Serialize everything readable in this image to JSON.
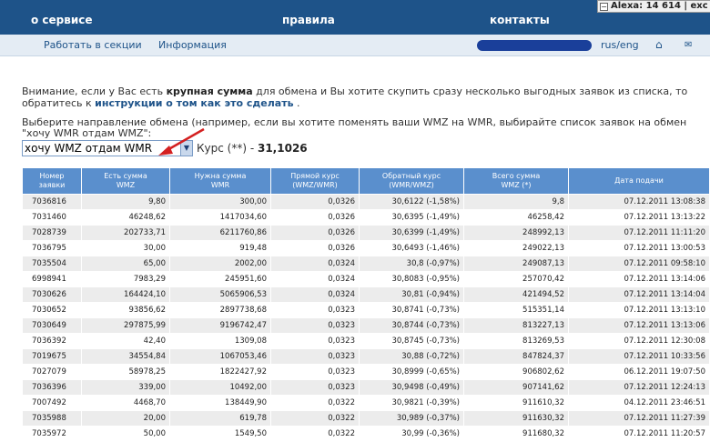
{
  "header": {
    "nav": [
      "о сервисе",
      "правила",
      "контакты"
    ],
    "alexa_label": "Alexa: 14 614 | exc",
    "alexa_box": "−"
  },
  "subnav": {
    "links": [
      "Работать в секции",
      "Информация"
    ],
    "lang": "rus/eng",
    "home_icon": "⌂",
    "mail_icon": "✉"
  },
  "notice": {
    "line1_a": "Внимание, если у Вас есть ",
    "line1_b": "крупная сумма",
    "line1_c": " для обмена и Вы хотите скупить сразу несколько выгодных заявок из списка, то",
    "line2_a": "обратитесь к ",
    "line2_b": "инструкции о том как это сделать",
    "line2_c": " ."
  },
  "direction": {
    "line1": "Выберите направление обмена (например, если вы хотите поменять ваши WMZ на WMR, выбирайте список заявок на обмен",
    "line2": "\"хочу WMR отдам WMZ\":",
    "selected": "хочу WMZ отдам WMR",
    "rate_label": "Курс (**) - ",
    "rate_value": "31,1026"
  },
  "table": {
    "headers": [
      [
        "Номер",
        "заявки"
      ],
      [
        "Есть сумма",
        "WMZ"
      ],
      [
        "Нужна сумма",
        "WMR"
      ],
      [
        "Прямой курс",
        "(WMZ/WMR)"
      ],
      [
        "Обратный курс",
        "(WMR/WMZ)"
      ],
      [
        "Всего сумма",
        "WMZ (*)"
      ],
      [
        "Дата подачи",
        ""
      ]
    ],
    "rows": [
      [
        "7036816",
        "9,80",
        "300,00",
        "0,0326",
        "30,6122 (-1,58%)",
        "9,8",
        "07.12.2011 13:08:38"
      ],
      [
        "7031460",
        "46248,62",
        "1417034,60",
        "0,0326",
        "30,6395 (-1,49%)",
        "46258,42",
        "07.12.2011 13:13:22"
      ],
      [
        "7028739",
        "202733,71",
        "6211760,86",
        "0,0326",
        "30,6399 (-1,49%)",
        "248992,13",
        "07.12.2011 11:11:20"
      ],
      [
        "7036795",
        "30,00",
        "919,48",
        "0,0326",
        "30,6493 (-1,46%)",
        "249022,13",
        "07.12.2011 13:00:53"
      ],
      [
        "7035504",
        "65,00",
        "2002,00",
        "0,0324",
        "30,8 (-0,97%)",
        "249087,13",
        "07.12.2011 09:58:10"
      ],
      [
        "6998941",
        "7983,29",
        "245951,60",
        "0,0324",
        "30,8083 (-0,95%)",
        "257070,42",
        "07.12.2011 13:14:06"
      ],
      [
        "7030626",
        "164424,10",
        "5065906,53",
        "0,0324",
        "30,81 (-0,94%)",
        "421494,52",
        "07.12.2011 13:14:04"
      ],
      [
        "7030652",
        "93856,62",
        "2897738,68",
        "0,0323",
        "30,8741 (-0,73%)",
        "515351,14",
        "07.12.2011 13:13:10"
      ],
      [
        "7030649",
        "297875,99",
        "9196742,47",
        "0,0323",
        "30,8744 (-0,73%)",
        "813227,13",
        "07.12.2011 13:13:06"
      ],
      [
        "7036392",
        "42,40",
        "1309,08",
        "0,0323",
        "30,8745 (-0,73%)",
        "813269,53",
        "07.12.2011 12:30:08"
      ],
      [
        "7019675",
        "34554,84",
        "1067053,46",
        "0,0323",
        "30,88 (-0,72%)",
        "847824,37",
        "07.12.2011 10:33:56"
      ],
      [
        "7027079",
        "58978,25",
        "1822427,92",
        "0,0323",
        "30,8999 (-0,65%)",
        "906802,62",
        "06.12.2011 19:07:50"
      ],
      [
        "7036396",
        "339,00",
        "10492,00",
        "0,0323",
        "30,9498 (-0,49%)",
        "907141,62",
        "07.12.2011 12:24:13"
      ],
      [
        "7007492",
        "4468,70",
        "138449,90",
        "0,0322",
        "30,9821 (-0,39%)",
        "911610,32",
        "04.12.2011 23:46:51"
      ],
      [
        "7035988",
        "20,00",
        "619,78",
        "0,0322",
        "30,989 (-0,37%)",
        "911630,32",
        "07.12.2011 11:27:39"
      ],
      [
        "7035972",
        "50,00",
        "1549,50",
        "0,0322",
        "30,99 (-0,36%)",
        "911680,32",
        "07.12.2011 11:20:57"
      ]
    ]
  },
  "colors": {
    "header_bg": "#1e5389",
    "subnav_bg": "#e4ecf4",
    "table_header_bg": "#5a8fcd",
    "row_alt_bg": "#ececec",
    "arrow": "#d42020"
  }
}
